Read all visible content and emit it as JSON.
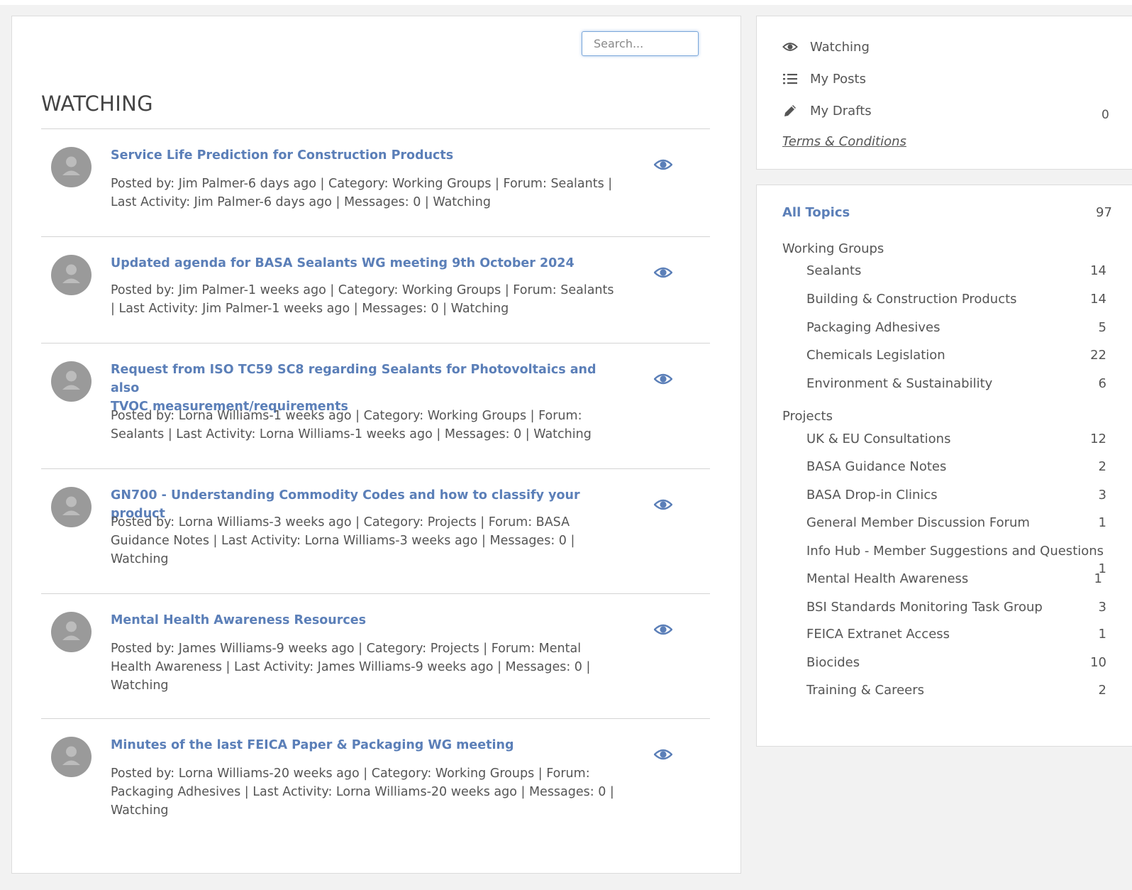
{
  "search": {
    "placeholder": "Search..."
  },
  "page_title": "WATCHING",
  "topics": [
    {
      "title": "Service Life Prediction for Construction Products",
      "meta_line1": "Posted by: Jim Palmer-6 days ago | Category: Working Groups | Forum: Sealants |",
      "meta_line2": "Last Activity: Jim Palmer-6 days ago | Messages: 0 | Watching",
      "meta_line3": ""
    },
    {
      "title": "Updated agenda for BASA Sealants WG meeting 9th October 2024",
      "meta_line1": "Posted by: Jim Palmer-1 weeks ago | Category: Working Groups | Forum: Sealants",
      "meta_line2": "| Last Activity: Jim Palmer-1 weeks ago | Messages: 0 | Watching",
      "meta_line3": ""
    },
    {
      "title_line1": "Request from ISO TC59 SC8 regarding Sealants for Photovoltaics and also",
      "title_line2": "TVOC measurement/requirements",
      "meta_line1": "Posted by: Lorna Williams-1 weeks ago | Category: Working Groups | Forum:",
      "meta_line2": "Sealants | Last Activity: Lorna Williams-1 weeks ago | Messages: 0 | Watching",
      "meta_line3": ""
    },
    {
      "title": "GN700 - Understanding Commodity Codes and how to classify your product",
      "meta_line1": "Posted by: Lorna Williams-3 weeks ago | Category: Projects | Forum: BASA",
      "meta_line2": "Guidance Notes | Last Activity: Lorna Williams-3 weeks ago | Messages: 0 |",
      "meta_line3": "Watching"
    },
    {
      "title": "Mental Health Awareness Resources",
      "meta_line1": "Posted by: James Williams-9 weeks ago | Category: Projects | Forum: Mental",
      "meta_line2": "Health Awareness | Last Activity: James Williams-9 weeks ago | Messages: 0 |",
      "meta_line3": "Watching"
    },
    {
      "title": "Minutes of the last FEICA Paper & Packaging WG meeting",
      "meta_line1": "Posted by: Lorna Williams-20 weeks ago | Category: Working Groups | Forum:",
      "meta_line2": "Packaging Adhesives | Last Activity: Lorna Williams-20 weeks ago | Messages: 0 |",
      "meta_line3": "Watching"
    }
  ],
  "sidebar": {
    "nav": [
      {
        "label": "Watching",
        "icon": "eye-icon"
      },
      {
        "label": "My Posts",
        "icon": "list-icon"
      },
      {
        "label": "My Drafts",
        "icon": "pencil-icon"
      }
    ],
    "drafts_count": "0",
    "terms": "Terms & Conditions"
  },
  "categories": {
    "all_label": "All Topics",
    "all_count": "97",
    "groups": [
      {
        "name": "Working Groups",
        "forums": [
          {
            "name": "Sealants",
            "count": "14"
          },
          {
            "name": "Building & Construction Products",
            "count": "14"
          },
          {
            "name": "Packaging Adhesives",
            "count": "5"
          },
          {
            "name": "Chemicals Legislation",
            "count": "22"
          },
          {
            "name": "Environment & Sustainability",
            "count": "6"
          }
        ]
      },
      {
        "name": "Projects",
        "forums": [
          {
            "name": "UK & EU Consultations",
            "count": "12"
          },
          {
            "name": "BASA Guidance Notes",
            "count": "2"
          },
          {
            "name": "BASA Drop-in Clinics",
            "count": "3"
          },
          {
            "name": "General Member Discussion Forum",
            "count": "1"
          },
          {
            "name": "Info Hub - Member Suggestions and Questions",
            "count": "1"
          },
          {
            "name": "Mental Health Awareness",
            "count": "1"
          },
          {
            "name": "BSI Standards Monitoring Task Group",
            "count": "3"
          },
          {
            "name": "FEICA Extranet Access",
            "count": "1"
          },
          {
            "name": "Biocides",
            "count": "10"
          },
          {
            "name": "Training & Careers",
            "count": "2"
          }
        ]
      }
    ]
  },
  "colors": {
    "link": "#5b7fb8",
    "text": "#555555",
    "background": "#f2f2f2"
  }
}
